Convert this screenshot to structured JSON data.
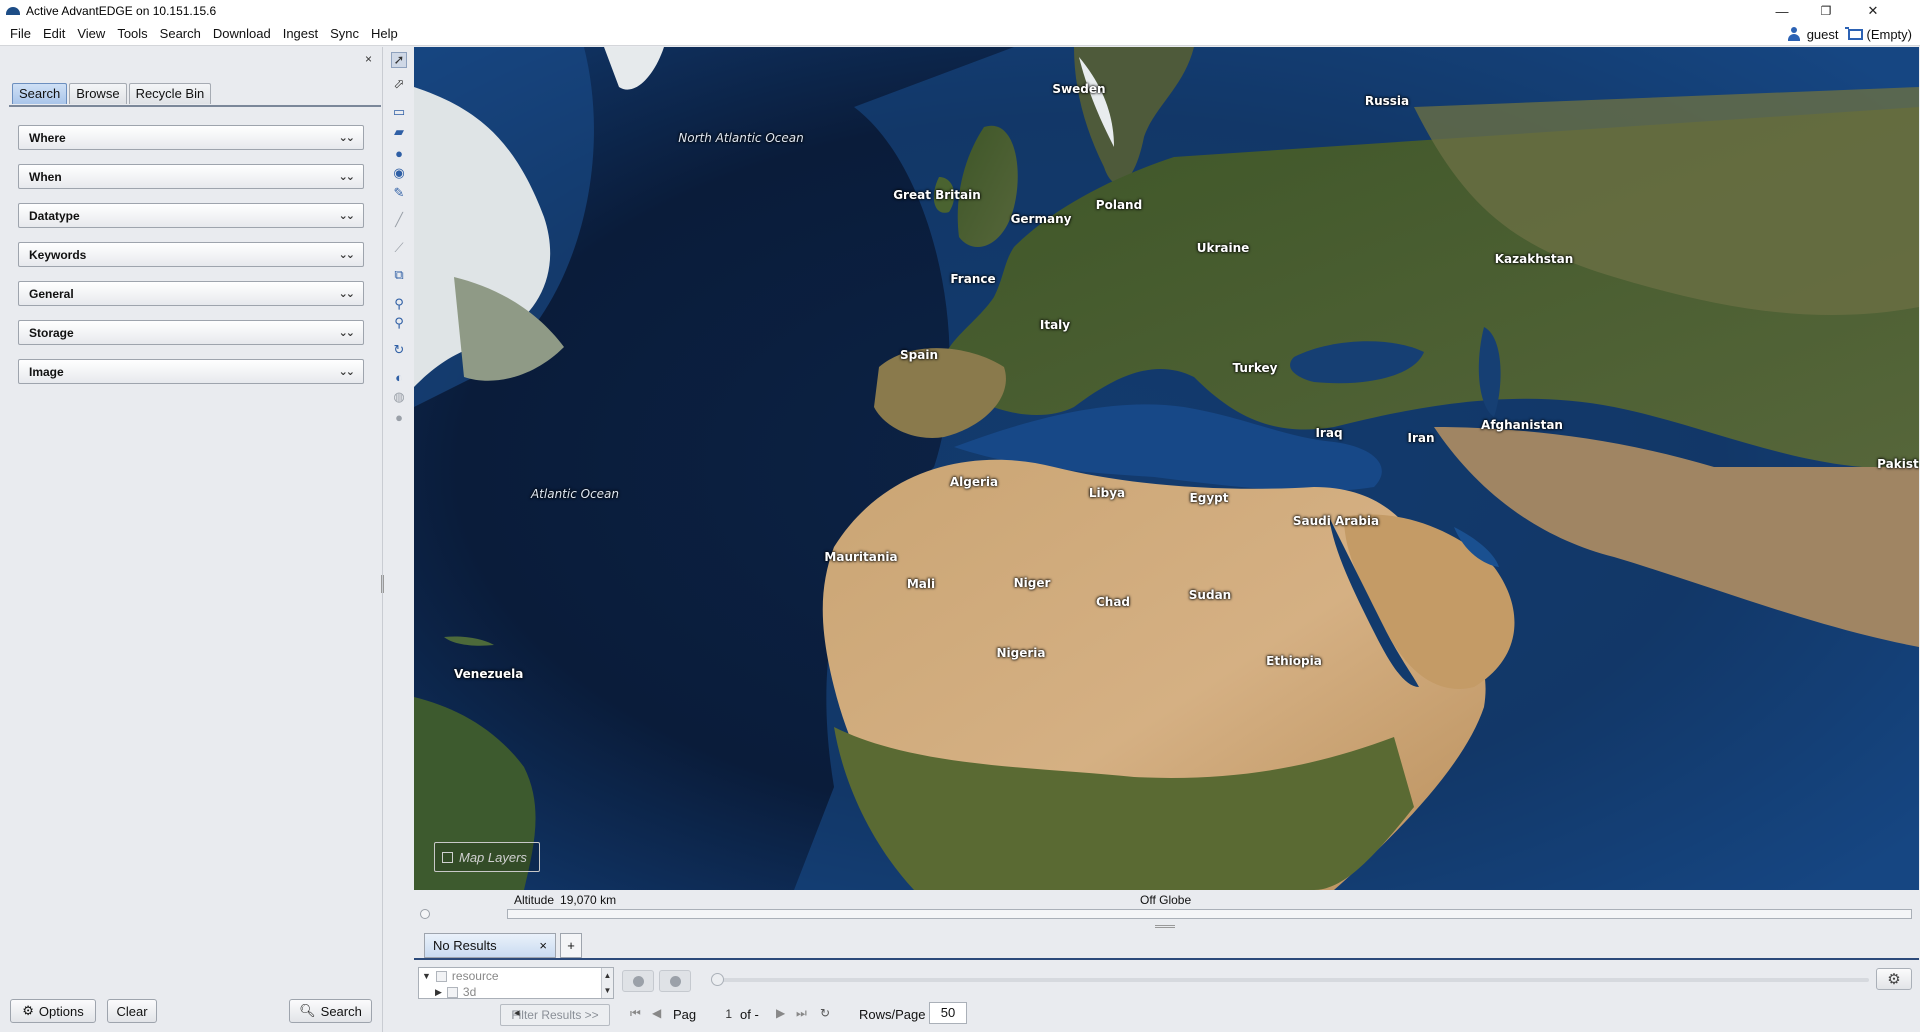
{
  "window": {
    "title": "Active AdvantEDGE on 10.151.15.6",
    "minimize": "—",
    "maximize": "❐",
    "close": "✕"
  },
  "menu": [
    "File",
    "Edit",
    "View",
    "Tools",
    "Search",
    "Download",
    "Ingest",
    "Sync",
    "Help"
  ],
  "user": {
    "name": "guest",
    "cart": "(Empty)"
  },
  "left_panel": {
    "close": "×",
    "tabs": [
      "Search",
      "Browse",
      "Recycle Bin"
    ],
    "active_tab": "Search",
    "sections": [
      "Where",
      "When",
      "Datatype",
      "Keywords",
      "General",
      "Storage",
      "Image"
    ],
    "options_label": "Options",
    "clear_label": "Clear",
    "search_label": "Search"
  },
  "map": {
    "labels": {
      "north_atlantic": "North Atlantic Ocean",
      "atlantic": "Atlantic Ocean",
      "sweden": "Sweden",
      "russia": "Russia",
      "great_britain": "Great Britain",
      "poland": "Poland",
      "germany": "Germany",
      "ukraine": "Ukraine",
      "kazakhstan": "Kazakhstan",
      "france": "France",
      "italy": "Italy",
      "spain": "Spain",
      "turkey": "Turkey",
      "afghanistan": "Afghanistan",
      "iraq": "Iraq",
      "iran": "Iran",
      "pakistan": "Pakista",
      "algeria": "Algeria",
      "libya": "Libya",
      "egypt": "Egypt",
      "saudi_arabia": "Saudi Arabia",
      "mauritania": "Mauritania",
      "mali": "Mali",
      "niger": "Niger",
      "chad": "Chad",
      "sudan": "Sudan",
      "nigeria": "Nigeria",
      "ethiopia": "Ethiopia",
      "venezuela": "Venezuela"
    },
    "layers_button": "Map Layers",
    "altitude_label": "Altitude",
    "altitude_value": "19,070 km",
    "position": "Off Globe"
  },
  "results": {
    "tab_label": "No Results",
    "tab_close": "×",
    "add_tab": "+",
    "tree": [
      "resource",
      "3d"
    ],
    "filter_label": "Filter Results >>",
    "page_label": "Page",
    "page_value": "1",
    "of_label": "of -",
    "rows_label": "Rows/Page",
    "rows_value": "50"
  }
}
